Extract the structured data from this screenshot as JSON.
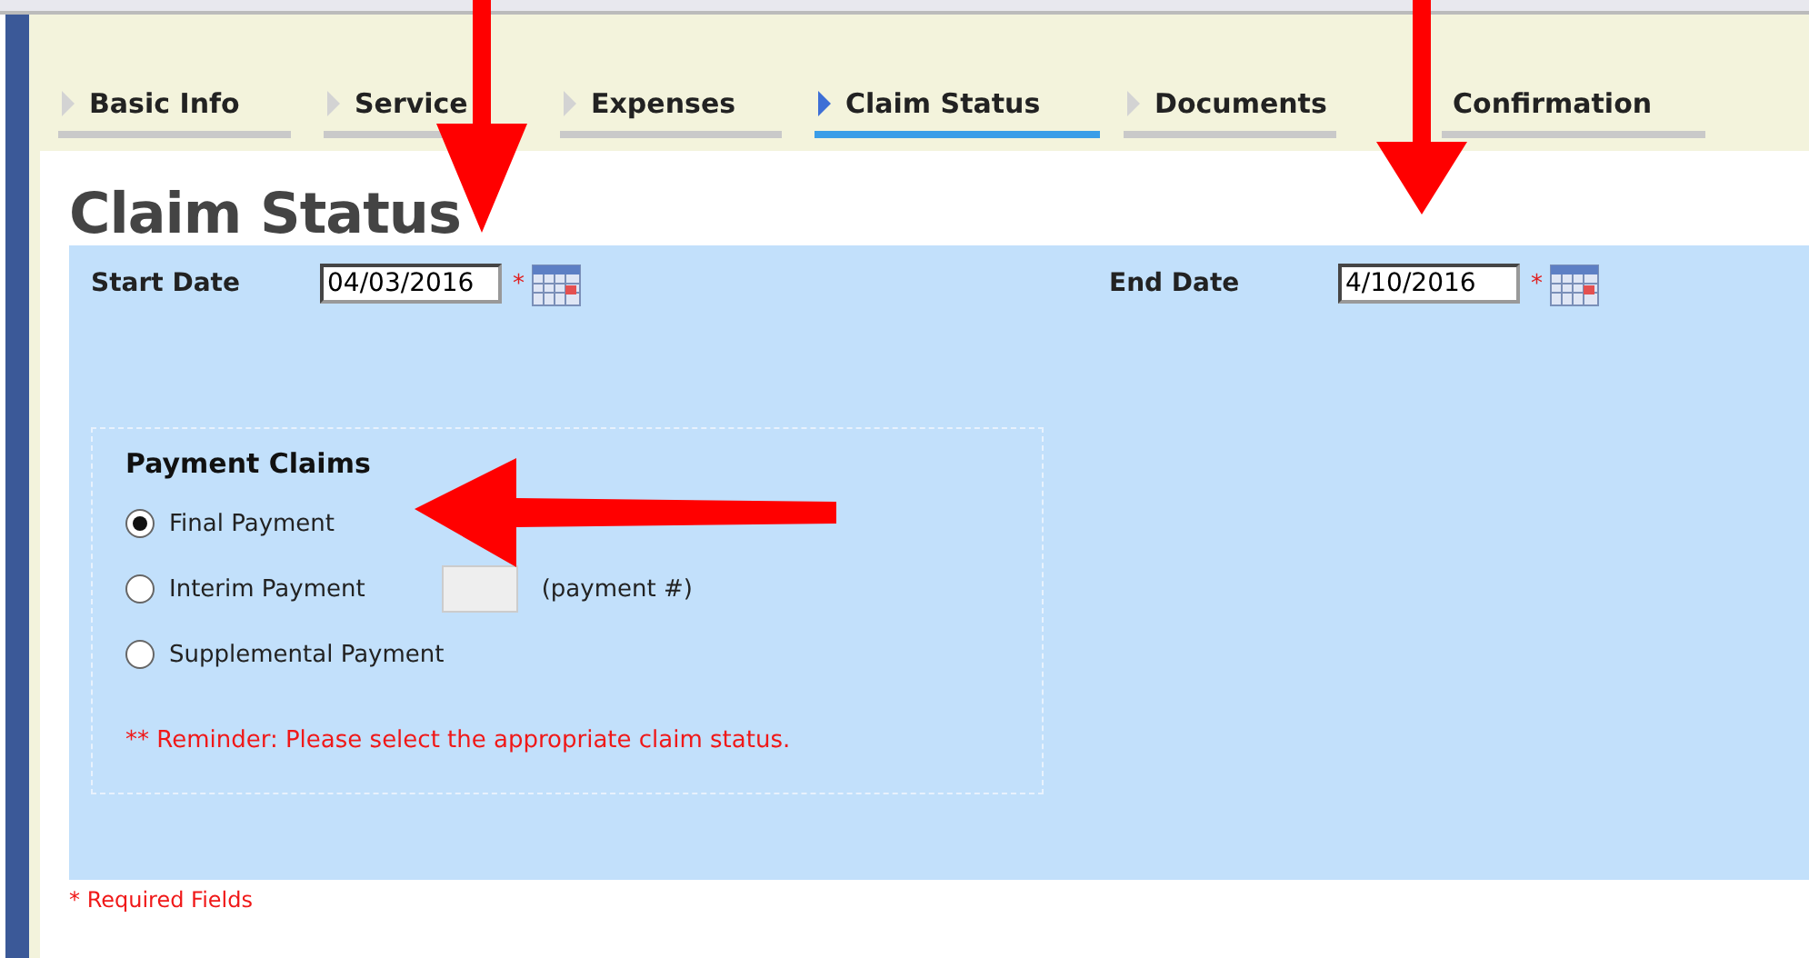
{
  "tabs": [
    {
      "label": "Basic Info",
      "selected": false,
      "marker": true
    },
    {
      "label": "Service",
      "selected": false,
      "marker": true
    },
    {
      "label": "Expenses",
      "selected": false,
      "marker": true
    },
    {
      "label": "Claim Status",
      "selected": true,
      "marker": true
    },
    {
      "label": "Documents",
      "selected": false,
      "marker": true
    },
    {
      "label": "Confirmation",
      "selected": false,
      "marker": false
    }
  ],
  "heading": "Claim Status",
  "date_fields": [
    {
      "label": "Start Date",
      "value": "04/03/2016",
      "required_mark": "*"
    },
    {
      "label": "End Date",
      "value": "4/10/2016",
      "required_mark": "*"
    }
  ],
  "payment_claims": {
    "title": "Payment Claims",
    "options": [
      {
        "label": "Final Payment",
        "selected": true,
        "kind": "plain"
      },
      {
        "label": "Interim Payment",
        "selected": false,
        "kind": "numbered",
        "field_hint": "(payment #)"
      },
      {
        "label": "Supplemental Payment",
        "selected": false,
        "kind": "plain"
      }
    ],
    "reminder": "** Reminder: Please select the appropriate claim status."
  },
  "required_note": "* Required Fields"
}
